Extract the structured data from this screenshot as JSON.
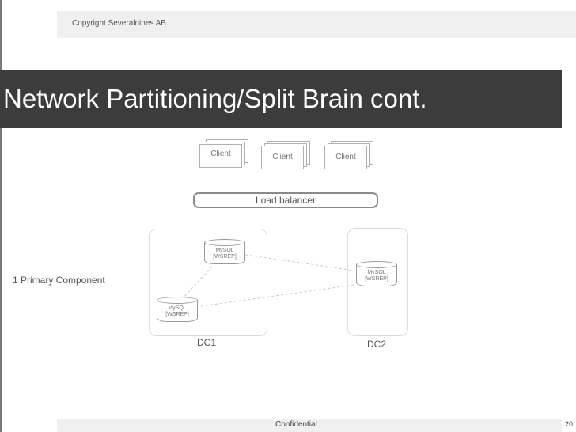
{
  "header": {
    "copyright": "Copyright Severalnines AB"
  },
  "title": "Network Partitioning/Split Brain cont.",
  "clients": [
    "Client",
    "Client",
    "Client"
  ],
  "load_balancer": "Load balancer",
  "datacenters": [
    {
      "label": "DC1"
    },
    {
      "label": "DC2"
    }
  ],
  "nodes": [
    {
      "line1": "MySQL",
      "line2": "[WSREP]"
    },
    {
      "line1": "MySQL",
      "line2": "[WSREP]"
    },
    {
      "line1": "MySQL",
      "line2": "[WSREP]"
    }
  ],
  "annotation": "1 Primary Component",
  "footer": {
    "confidential": "Confidential",
    "page": "20"
  }
}
